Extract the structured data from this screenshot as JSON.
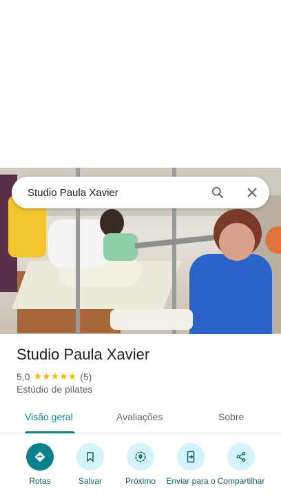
{
  "search": {
    "query": "Studio Paula Xavier",
    "search_icon": "search-icon",
    "close_icon": "close-icon"
  },
  "place": {
    "name": "Studio Paula Xavier",
    "rating": "5,0",
    "stars": "★★★★★",
    "reviews": "(5)",
    "category": "Estúdio de pilates"
  },
  "tabs": [
    {
      "label": "Visão geral"
    },
    {
      "label": "Avaliações"
    },
    {
      "label": "Sobre"
    }
  ],
  "actions": [
    {
      "label": "Rotas"
    },
    {
      "label": "Salvar"
    },
    {
      "label": "Próximo"
    },
    {
      "label": "Enviar para o"
    },
    {
      "label": "Compartilhar"
    }
  ],
  "colors": {
    "accent": "#0b7f8a",
    "chip": "#d4f4fb",
    "star": "#f4b400"
  }
}
